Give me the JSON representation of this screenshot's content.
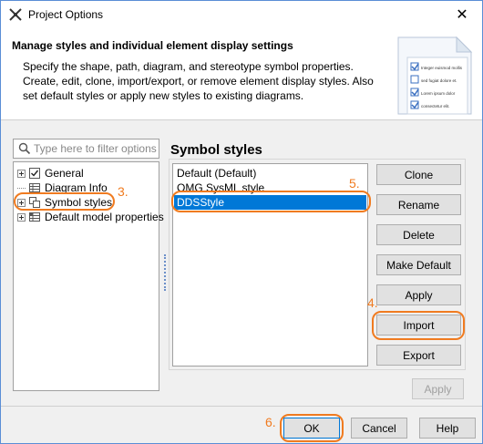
{
  "window": {
    "title": "Project Options",
    "close_glyph": "✕"
  },
  "header": {
    "heading": "Manage styles and individual element display settings",
    "description": "Specify the shape, path, diagram, and stereotype symbol properties. Create, edit, clone, import/export, or remove element display styles. Also set default styles or apply new styles to existing diagrams.",
    "illustration_lines": [
      "Integer euismod mollis",
      "sed fugiat dolore et.",
      "Lorem ipsum dolor",
      "consectetur elit."
    ]
  },
  "filter": {
    "placeholder": "Type here to filter options",
    "value": ""
  },
  "tree": {
    "items": [
      {
        "label": "General",
        "icon": "checkbox-icon",
        "expandable": true
      },
      {
        "label": "Diagram Info",
        "icon": "table-icon",
        "expandable": false
      },
      {
        "label": "Symbol styles",
        "icon": "symbols-icon",
        "expandable": true
      },
      {
        "label": "Default model properties",
        "icon": "properties-icon",
        "expandable": true
      }
    ]
  },
  "main": {
    "title": "Symbol styles",
    "styles": [
      {
        "label": "Default (Default)",
        "selected": false
      },
      {
        "label": "OMG SysML style",
        "selected": false
      },
      {
        "label": "DDSStyle",
        "selected": true
      }
    ],
    "buttons": {
      "clone": "Clone",
      "rename": "Rename",
      "delete": "Delete",
      "make_default": "Make Default",
      "apply": "Apply",
      "import": "Import",
      "export": "Export"
    },
    "apply_panel": "Apply"
  },
  "footer": {
    "ok": "OK",
    "cancel": "Cancel",
    "help": "Help"
  },
  "callouts": {
    "step3": "3.",
    "step4": "4.",
    "step5": "5.",
    "step6": "6."
  },
  "colors": {
    "selection": "#0078d7",
    "callout": "#f07b20",
    "window_border": "#5a8ed6"
  }
}
